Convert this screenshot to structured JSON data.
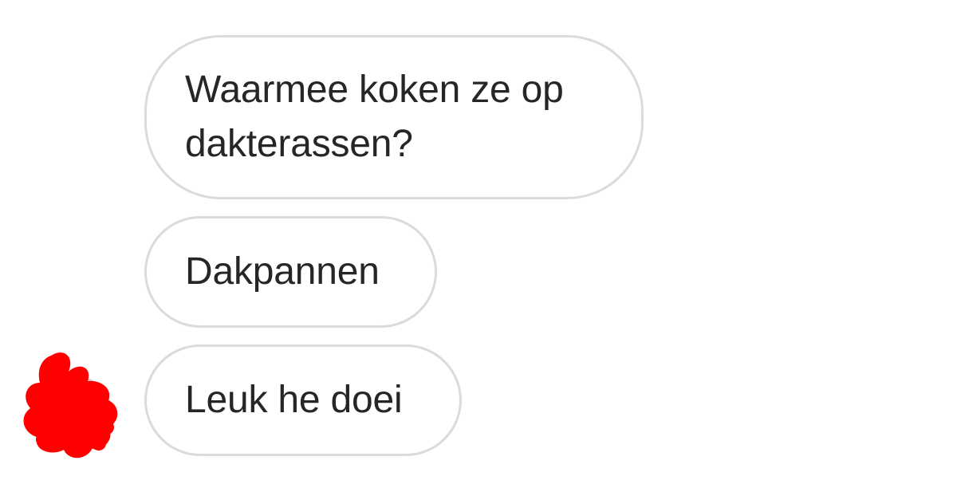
{
  "messages": [
    {
      "text": "Waarmee koken ze op dakterassen?"
    },
    {
      "text": "Dakpannen"
    },
    {
      "text": "Leuk he doei"
    }
  ],
  "colors": {
    "bubble_border": "#dbdbdb",
    "text": "#262626",
    "redaction": "#ff0000",
    "background": "#ffffff"
  },
  "icons": {
    "avatar": "redacted-avatar-icon"
  }
}
